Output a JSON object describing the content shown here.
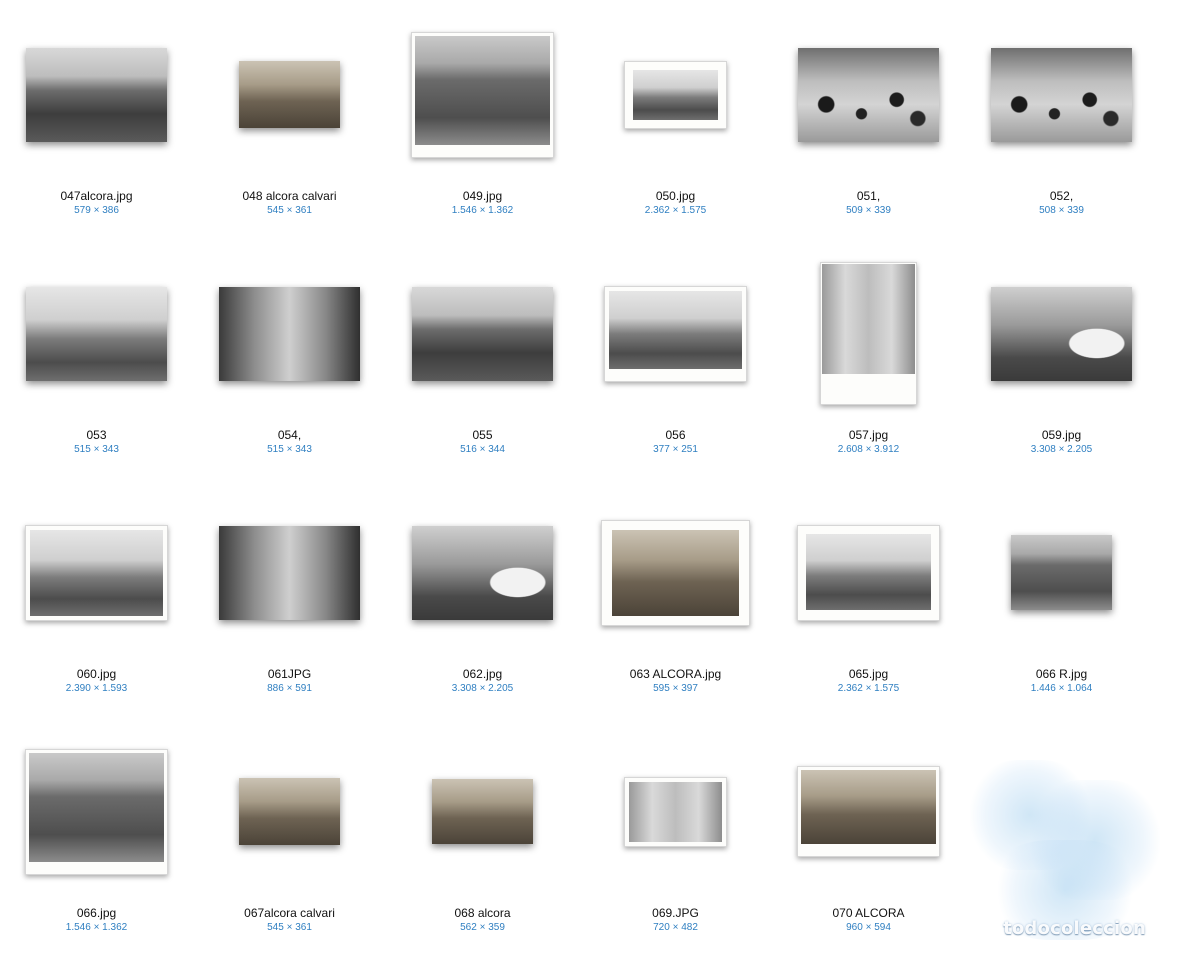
{
  "files": [
    {
      "name": "047alcora.jpg",
      "dims": "579 × 386"
    },
    {
      "name": "048 alcora calvari",
      "dims": "545 × 361"
    },
    {
      "name": "049.jpg",
      "dims": "1.546 × 1.362"
    },
    {
      "name": "050.jpg",
      "dims": "2.362 × 1.575"
    },
    {
      "name": "051,",
      "dims": "509 × 339"
    },
    {
      "name": "052,",
      "dims": "508 × 339"
    },
    {
      "name": "053",
      "dims": "515 × 343"
    },
    {
      "name": "054,",
      "dims": "515 × 343"
    },
    {
      "name": "055",
      "dims": "516 × 344"
    },
    {
      "name": "056",
      "dims": "377 × 251"
    },
    {
      "name": "057.jpg",
      "dims": "2.608 × 3.912"
    },
    {
      "name": "059.jpg",
      "dims": "3.308 × 2.205"
    },
    {
      "name": "060.jpg",
      "dims": "2.390 × 1.593"
    },
    {
      "name": "061JPG",
      "dims": "886 × 591"
    },
    {
      "name": "062.jpg",
      "dims": "3.308 × 2.205"
    },
    {
      "name": "063 ALCORA.jpg",
      "dims": "595 × 397"
    },
    {
      "name": "065.jpg",
      "dims": "2.362 × 1.575"
    },
    {
      "name": "066 R.jpg",
      "dims": "1.446 × 1.064"
    },
    {
      "name": "066.jpg",
      "dims": "1.546 × 1.362"
    },
    {
      "name": "067alcora calvari",
      "dims": "545 × 361"
    },
    {
      "name": "068 alcora",
      "dims": "562 × 359"
    },
    {
      "name": "069.JPG",
      "dims": "720 × 482"
    },
    {
      "name": "070 ALCORA",
      "dims": "960 × 594"
    }
  ],
  "watermark": {
    "text": "todocoleccion"
  }
}
